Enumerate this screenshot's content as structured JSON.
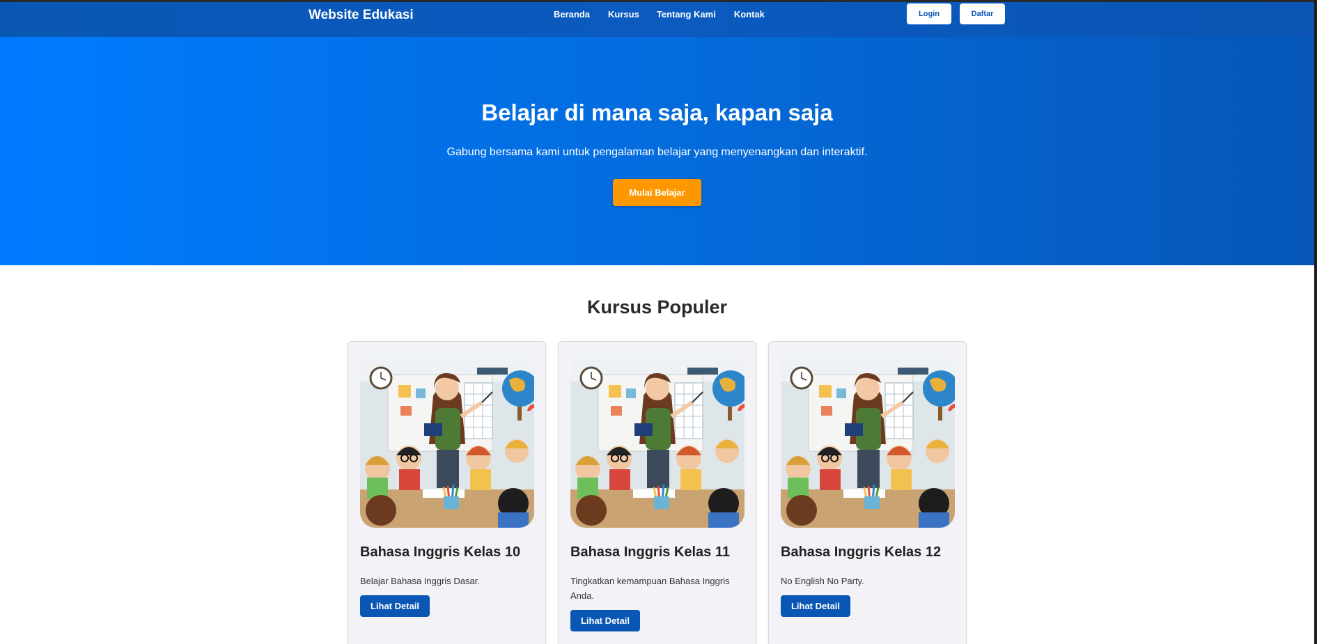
{
  "nav": {
    "brand": "Website Edukasi",
    "links": [
      "Beranda",
      "Kursus",
      "Tentang Kami",
      "Kontak"
    ],
    "login_label": "Login",
    "signup_label": "Daftar"
  },
  "hero": {
    "title": "Belajar di mana saja, kapan saja",
    "subtitle": "Gabung bersama kami untuk pengalaman belajar yang menyenangkan dan interaktif.",
    "cta_label": "Mulai Belajar"
  },
  "courses": {
    "title": "Kursus Populer",
    "items": [
      {
        "title": "Bahasa Inggris Kelas 10",
        "desc": "Belajar Bahasa Inggris Dasar.",
        "button": "Lihat Detail"
      },
      {
        "title": "Bahasa Inggris Kelas 11",
        "desc": "Tingkatkan kemampuan Bahasa Inggris Anda.",
        "button": "Lihat Detail"
      },
      {
        "title": "Bahasa Inggris Kelas 12",
        "desc": "No English No Party.",
        "button": "Lihat Detail"
      }
    ]
  },
  "colors": {
    "nav_blue": "#0a57b3",
    "hero_start": "#007bff",
    "hero_end": "#0656b8",
    "cta_orange": "#ff9800",
    "button_blue": "#0a56b5"
  }
}
